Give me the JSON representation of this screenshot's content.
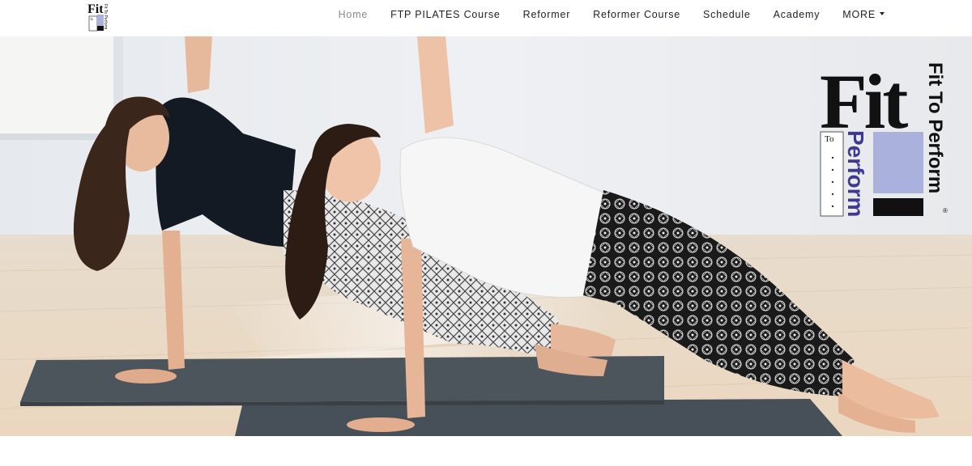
{
  "brand": {
    "name": "Fit To Perform",
    "logo_big_word": "Fit",
    "logo_to": "To",
    "logo_perform": "Perform",
    "logo_side_text": "Fit To Perform",
    "registered_mark": "®",
    "colors": {
      "black": "#111111",
      "purple": "#3d3a8f",
      "lavender": "#a9b1dc"
    }
  },
  "nav": {
    "items": [
      {
        "label": "Home",
        "active": true
      },
      {
        "label": "FTP PILATES Course",
        "active": false
      },
      {
        "label": "Reformer",
        "active": false
      },
      {
        "label": "Reformer Course",
        "active": false
      },
      {
        "label": "Schedule",
        "active": false
      },
      {
        "label": "Academy",
        "active": false
      }
    ],
    "more_label": "MORE"
  },
  "hero": {
    "image_description_icon": "pilates-side-plank-photo"
  }
}
